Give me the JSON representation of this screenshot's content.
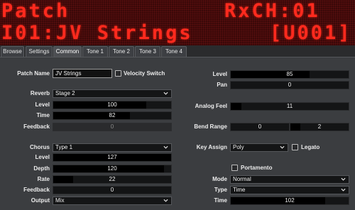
{
  "display": {
    "line1_left": "Patch",
    "line1_right": "RxCH:01",
    "line2_left": "I01:JV Strings",
    "line2_right": "[U001]"
  },
  "tabs": [
    "Browse",
    "Settings",
    "Common",
    "Tone 1",
    "Tone 2",
    "Tone 3",
    "Tone 4"
  ],
  "active_tab": "Common",
  "patch": {
    "name_label": "Patch Name",
    "name_value": "JV Strings",
    "velocity_switch_label": "Velocity Switch"
  },
  "reverb": {
    "label": "Reverb",
    "type": "Stage 2",
    "level_label": "Level",
    "level": "100",
    "level_fraction": 0.79,
    "time_label": "Time",
    "time": "82",
    "time_fraction": 0.65,
    "feedback_label": "Feedback",
    "feedback": "0"
  },
  "chorus": {
    "label": "Chorus",
    "type": "Type 1",
    "level_label": "Level",
    "level": "127",
    "level_fraction": 1.0,
    "depth_label": "Depth",
    "depth": "120",
    "depth_fraction": 0.94,
    "rate_label": "Rate",
    "rate": "22",
    "rate_fraction": 0.17,
    "feedback_label": "Feedback",
    "feedback": "0",
    "output_label": "Output",
    "output": "Mix"
  },
  "right": {
    "level_label": "Level",
    "level": "85",
    "level_fraction": 0.67,
    "pan_label": "Pan",
    "pan": "0",
    "analog_feel_label": "Analog Feel",
    "analog_feel": "11",
    "analog_feel_fraction": 0.09,
    "bend_range_label": "Bend Range",
    "bend_down": "0",
    "bend_up": "2",
    "key_assign_label": "Key Assign",
    "key_assign": "Poly",
    "legato_label": "Legato",
    "portamento_label": "Portamento",
    "mode_label": "Mode",
    "mode": "Normal",
    "type_label": "Type",
    "type": "Time",
    "time_label": "Time",
    "time": "102",
    "time_fraction": 0.8
  },
  "colors": {
    "led_text": "#ff2a1e",
    "led_background": "#380808",
    "panel": "#3b3d40",
    "field": "#141516"
  }
}
